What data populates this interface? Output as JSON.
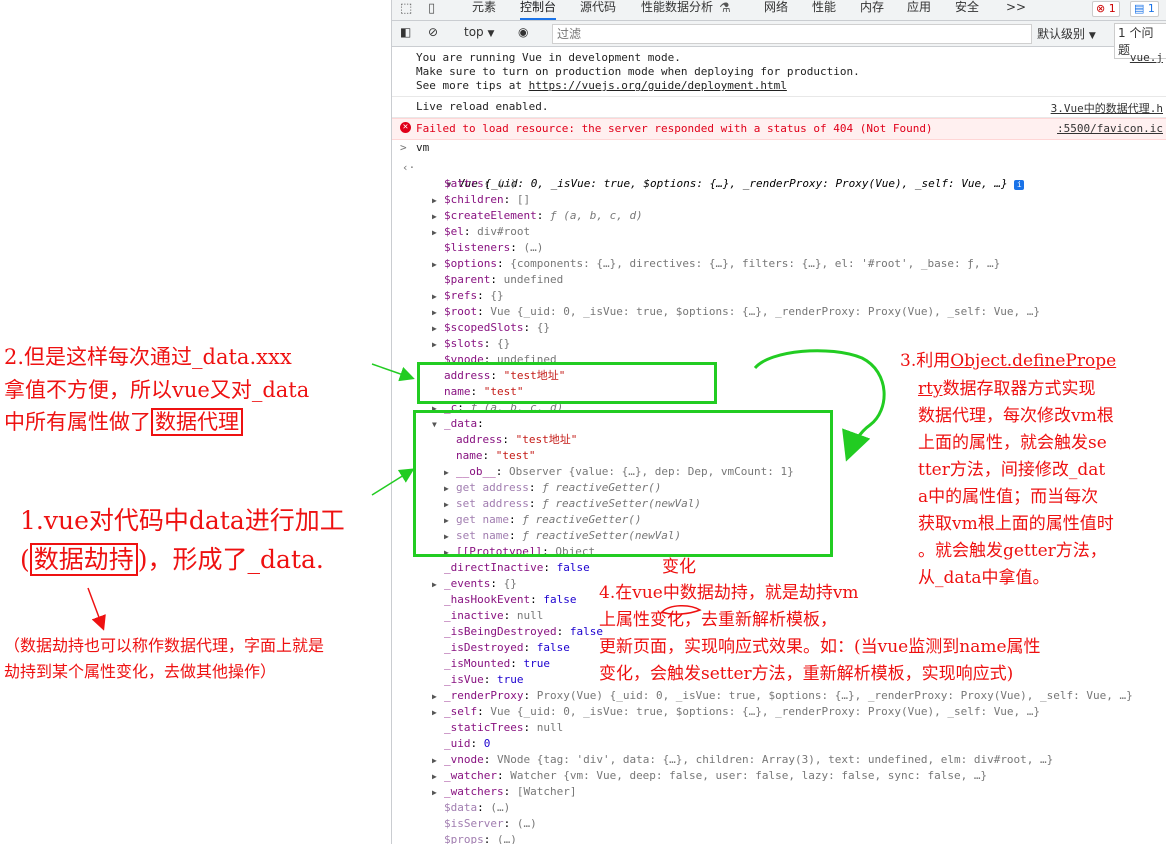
{
  "devtools": {
    "tabs": [
      "元素",
      "控制台",
      "源代码",
      "性能数据分析",
      "网络",
      "性能",
      "内存",
      "应用",
      "安全"
    ],
    "more_tabs_icon": ">>",
    "error_count": "1",
    "message_count": "1",
    "toolbar": {
      "context": "top",
      "filter_placeholder": "过滤",
      "level": "默认级别",
      "issues": "1 个问题"
    }
  },
  "console": {
    "vue_dev_line1": "You are running Vue in development mode.",
    "vue_dev_line2": "Make sure to turn on production mode when deploying for production.",
    "vue_dev_line3_prefix": "See more tips at ",
    "vue_dev_link": "https://vuejs.org/guide/deployment.html",
    "vue_dev_source": "vue.j",
    "live_reload": "Live reload enabled.",
    "live_reload_source": "3.Vue中的数据代理.h",
    "error_text": "Failed to load resource: the server responded with a status of 404 (Not Found)",
    "error_source": ":5500/favicon.ic",
    "input_cmd": "vm",
    "vue_summary": "Vue {_uid: 0, _isVue: true, $options: {…}, _renderProxy: Proxy(Vue), _self: Vue, …}"
  },
  "tree": [
    {
      "key": "$attrs",
      "val": "(…)",
      "indent": 1,
      "dim": false,
      "expandable": false
    },
    {
      "key": "$children",
      "val": "[]",
      "indent": 1,
      "dim": false,
      "expandable": true
    },
    {
      "key": "$createElement",
      "val": "ƒ (a, b, c, d)",
      "indent": 1,
      "dim": false,
      "expandable": true
    },
    {
      "key": "$el",
      "val": "div#root",
      "indent": 1,
      "dim": false,
      "expandable": true
    },
    {
      "key": "$listeners",
      "val": "(…)",
      "indent": 1,
      "dim": false,
      "expandable": false
    },
    {
      "key": "$options",
      "val": "{components: {…}, directives: {…}, filters: {…}, el: '#root', _base: ƒ, …}",
      "indent": 1,
      "dim": false,
      "expandable": true
    },
    {
      "key": "$parent",
      "val": "undefined",
      "indent": 1,
      "dim": false,
      "expandable": false
    },
    {
      "key": "$refs",
      "val": "{}",
      "indent": 1,
      "dim": false,
      "expandable": true
    },
    {
      "key": "$root",
      "val": "Vue {_uid: 0, _isVue: true, $options: {…}, _renderProxy: Proxy(Vue), _self: Vue, …}",
      "indent": 1,
      "dim": false,
      "expandable": true
    },
    {
      "key": "$scopedSlots",
      "val": "{}",
      "indent": 1,
      "dim": false,
      "expandable": true
    },
    {
      "key": "$slots",
      "val": "{}",
      "indent": 1,
      "dim": false,
      "expandable": true
    },
    {
      "key": "$vnode",
      "val": "undefined",
      "indent": 1,
      "dim": false,
      "expandable": false
    },
    {
      "key": "address",
      "val": "\"test地址\"",
      "indent": 1,
      "dim": false,
      "expandable": false
    },
    {
      "key": "name",
      "val": "\"test\"",
      "indent": 1,
      "dim": false,
      "expandable": false
    },
    {
      "key": "_c",
      "val": "ƒ (a, b, c, d)",
      "indent": 1,
      "dim": false,
      "expandable": true
    },
    {
      "key": "_data",
      "val": "",
      "indent": 1,
      "dim": false,
      "expandable": true,
      "open": true
    },
    {
      "key": "address",
      "val": "\"test地址\"",
      "indent": 2,
      "dim": false,
      "expandable": false
    },
    {
      "key": "name",
      "val": "\"test\"",
      "indent": 2,
      "dim": false,
      "expandable": false
    },
    {
      "key": "__ob__",
      "val": "Observer {value: {…}, dep: Dep, vmCount: 1}",
      "indent": 2,
      "dim": false,
      "expandable": true
    },
    {
      "key": "get address",
      "val": "ƒ reactiveGetter()",
      "indent": 2,
      "dim": true,
      "expandable": true
    },
    {
      "key": "set address",
      "val": "ƒ reactiveSetter(newVal)",
      "indent": 2,
      "dim": true,
      "expandable": true
    },
    {
      "key": "get name",
      "val": "ƒ reactiveGetter()",
      "indent": 2,
      "dim": true,
      "expandable": true
    },
    {
      "key": "set name",
      "val": "ƒ reactiveSetter(newVal)",
      "indent": 2,
      "dim": true,
      "expandable": true
    },
    {
      "key": "[[Prototype]]",
      "val": "Object",
      "indent": 2,
      "dim": false,
      "expandable": true
    },
    {
      "key": "_directInactive",
      "val": "false",
      "indent": 1,
      "dim": false,
      "expandable": false
    },
    {
      "key": "_events",
      "val": "{}",
      "indent": 1,
      "dim": false,
      "expandable": true
    },
    {
      "key": "_hasHookEvent",
      "val": "false",
      "indent": 1,
      "dim": false,
      "expandable": false
    },
    {
      "key": "_inactive",
      "val": "null",
      "indent": 1,
      "dim": false,
      "expandable": false
    },
    {
      "key": "_isBeingDestroyed",
      "val": "false",
      "indent": 1,
      "dim": false,
      "expandable": false
    },
    {
      "key": "_isDestroyed",
      "val": "false",
      "indent": 1,
      "dim": false,
      "expandable": false
    },
    {
      "key": "_isMounted",
      "val": "true",
      "indent": 1,
      "dim": false,
      "expandable": false
    },
    {
      "key": "_isVue",
      "val": "true",
      "indent": 1,
      "dim": false,
      "expandable": false
    },
    {
      "key": "_renderProxy",
      "val": "Proxy(Vue) {_uid: 0, _isVue: true, $options: {…}, _renderProxy: Proxy(Vue), _self: Vue, …}",
      "indent": 1,
      "dim": false,
      "expandable": true
    },
    {
      "key": "_self",
      "val": "Vue {_uid: 0, _isVue: true, $options: {…}, _renderProxy: Proxy(Vue), _self: Vue, …}",
      "indent": 1,
      "dim": false,
      "expandable": true
    },
    {
      "key": "_staticTrees",
      "val": "null",
      "indent": 1,
      "dim": false,
      "expandable": false
    },
    {
      "key": "_uid",
      "val": "0",
      "indent": 1,
      "dim": false,
      "expandable": false
    },
    {
      "key": "_vnode",
      "val": "VNode {tag: 'div', data: {…}, children: Array(3), text: undefined, elm: div#root, …}",
      "indent": 1,
      "dim": false,
      "expandable": true
    },
    {
      "key": "_watcher",
      "val": "Watcher {vm: Vue, deep: false, user: false, lazy: false, sync: false, …}",
      "indent": 1,
      "dim": false,
      "expandable": true
    },
    {
      "key": "_watchers",
      "val": "[Watcher]",
      "indent": 1,
      "dim": false,
      "expandable": true
    },
    {
      "key": "$data",
      "val": "(…)",
      "indent": 1,
      "dim": true,
      "expandable": false
    },
    {
      "key": "$isServer",
      "val": "(…)",
      "indent": 1,
      "dim": true,
      "expandable": false
    },
    {
      "key": "$props",
      "val": "(…)",
      "indent": 1,
      "dim": true,
      "expandable": false
    }
  ],
  "annotations": {
    "a2_line1": "2.但是这样每次通过_data.xxx",
    "a2_line2": "拿值不方便，所以vue又对_data",
    "a2_line3_prefix": "中所有属性做了",
    "a2_line3_boxed": "数据代理",
    "a1_line1": "1.vue对代码中data进行加工",
    "a1_line2_open": "(",
    "a1_line2_boxed": "数据劫持",
    "a1_line2_rest": ")，形成了_data.",
    "a1_note_line1": "（数据劫持也可以称作数据代理，字面上就是",
    "a1_note_line2": "劫持到某个属性变化，去做其他操作）",
    "a3_prefix": "3.利用",
    "a3_code1": "Object.definePrope",
    "a3_code2": "rty",
    "a3_line2_rest": "数据存取器方式实现",
    "a3_line3": "数据代理，每次修改vm根",
    "a3_line4": "上面的属性，就会触发se",
    "a3_line5": "tter方法，间接修改_dat",
    "a3_line6": "a中的属性值；而当每次",
    "a3_line7": "获取vm根上面的属性值时",
    "a3_line8": "。就会触发getter方法，",
    "a3_line9": "从_data中拿值。",
    "a4_floating": "变化",
    "a4_line1": "4.在vue中数据劫持，就是劫持vm",
    "a4_line2": "上属性变化，去重新解析模板，",
    "a4_line3": "更新页面，实现响应式效果。如：(当vue监测到name属性",
    "a4_line4": "变化，会触发setter方法，重新解析模板，实现响应式)"
  },
  "colors": {
    "annotation_red": "#ee1111",
    "highlight_green": "#22cc22",
    "devtools_blue": "#1a73e8"
  }
}
